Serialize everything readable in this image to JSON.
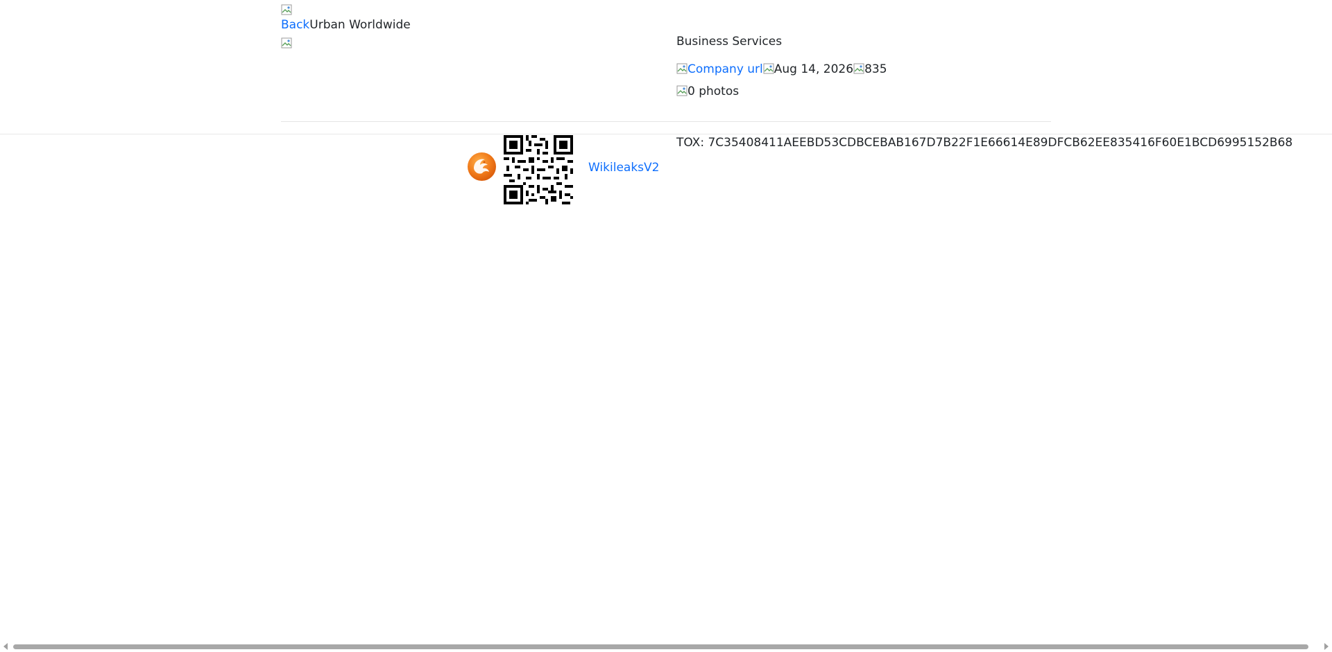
{
  "header": {
    "back_link": "Back",
    "company_name": "Urban Worldwide"
  },
  "details": {
    "category": "Business Services",
    "company_url_link": "Company url",
    "date": "Aug 14, 2026",
    "views": "835",
    "photos": "0 photos"
  },
  "footer": {
    "wikileaks_link": "WikileaksV2",
    "tox_line": "TOX: 7C35408411AEEBD53CDBCEBAB167D7B22F1E66614E89DFCB62EE835416F60E1BCD6995152B68"
  },
  "icons": {
    "broken_image": "broken-image-icon",
    "logo": "phoenix-logo-icon",
    "qr": "qr-code-icon"
  },
  "colors": {
    "link": "#0d6efd",
    "text": "#212529",
    "logo_orange": "#f0761a"
  }
}
